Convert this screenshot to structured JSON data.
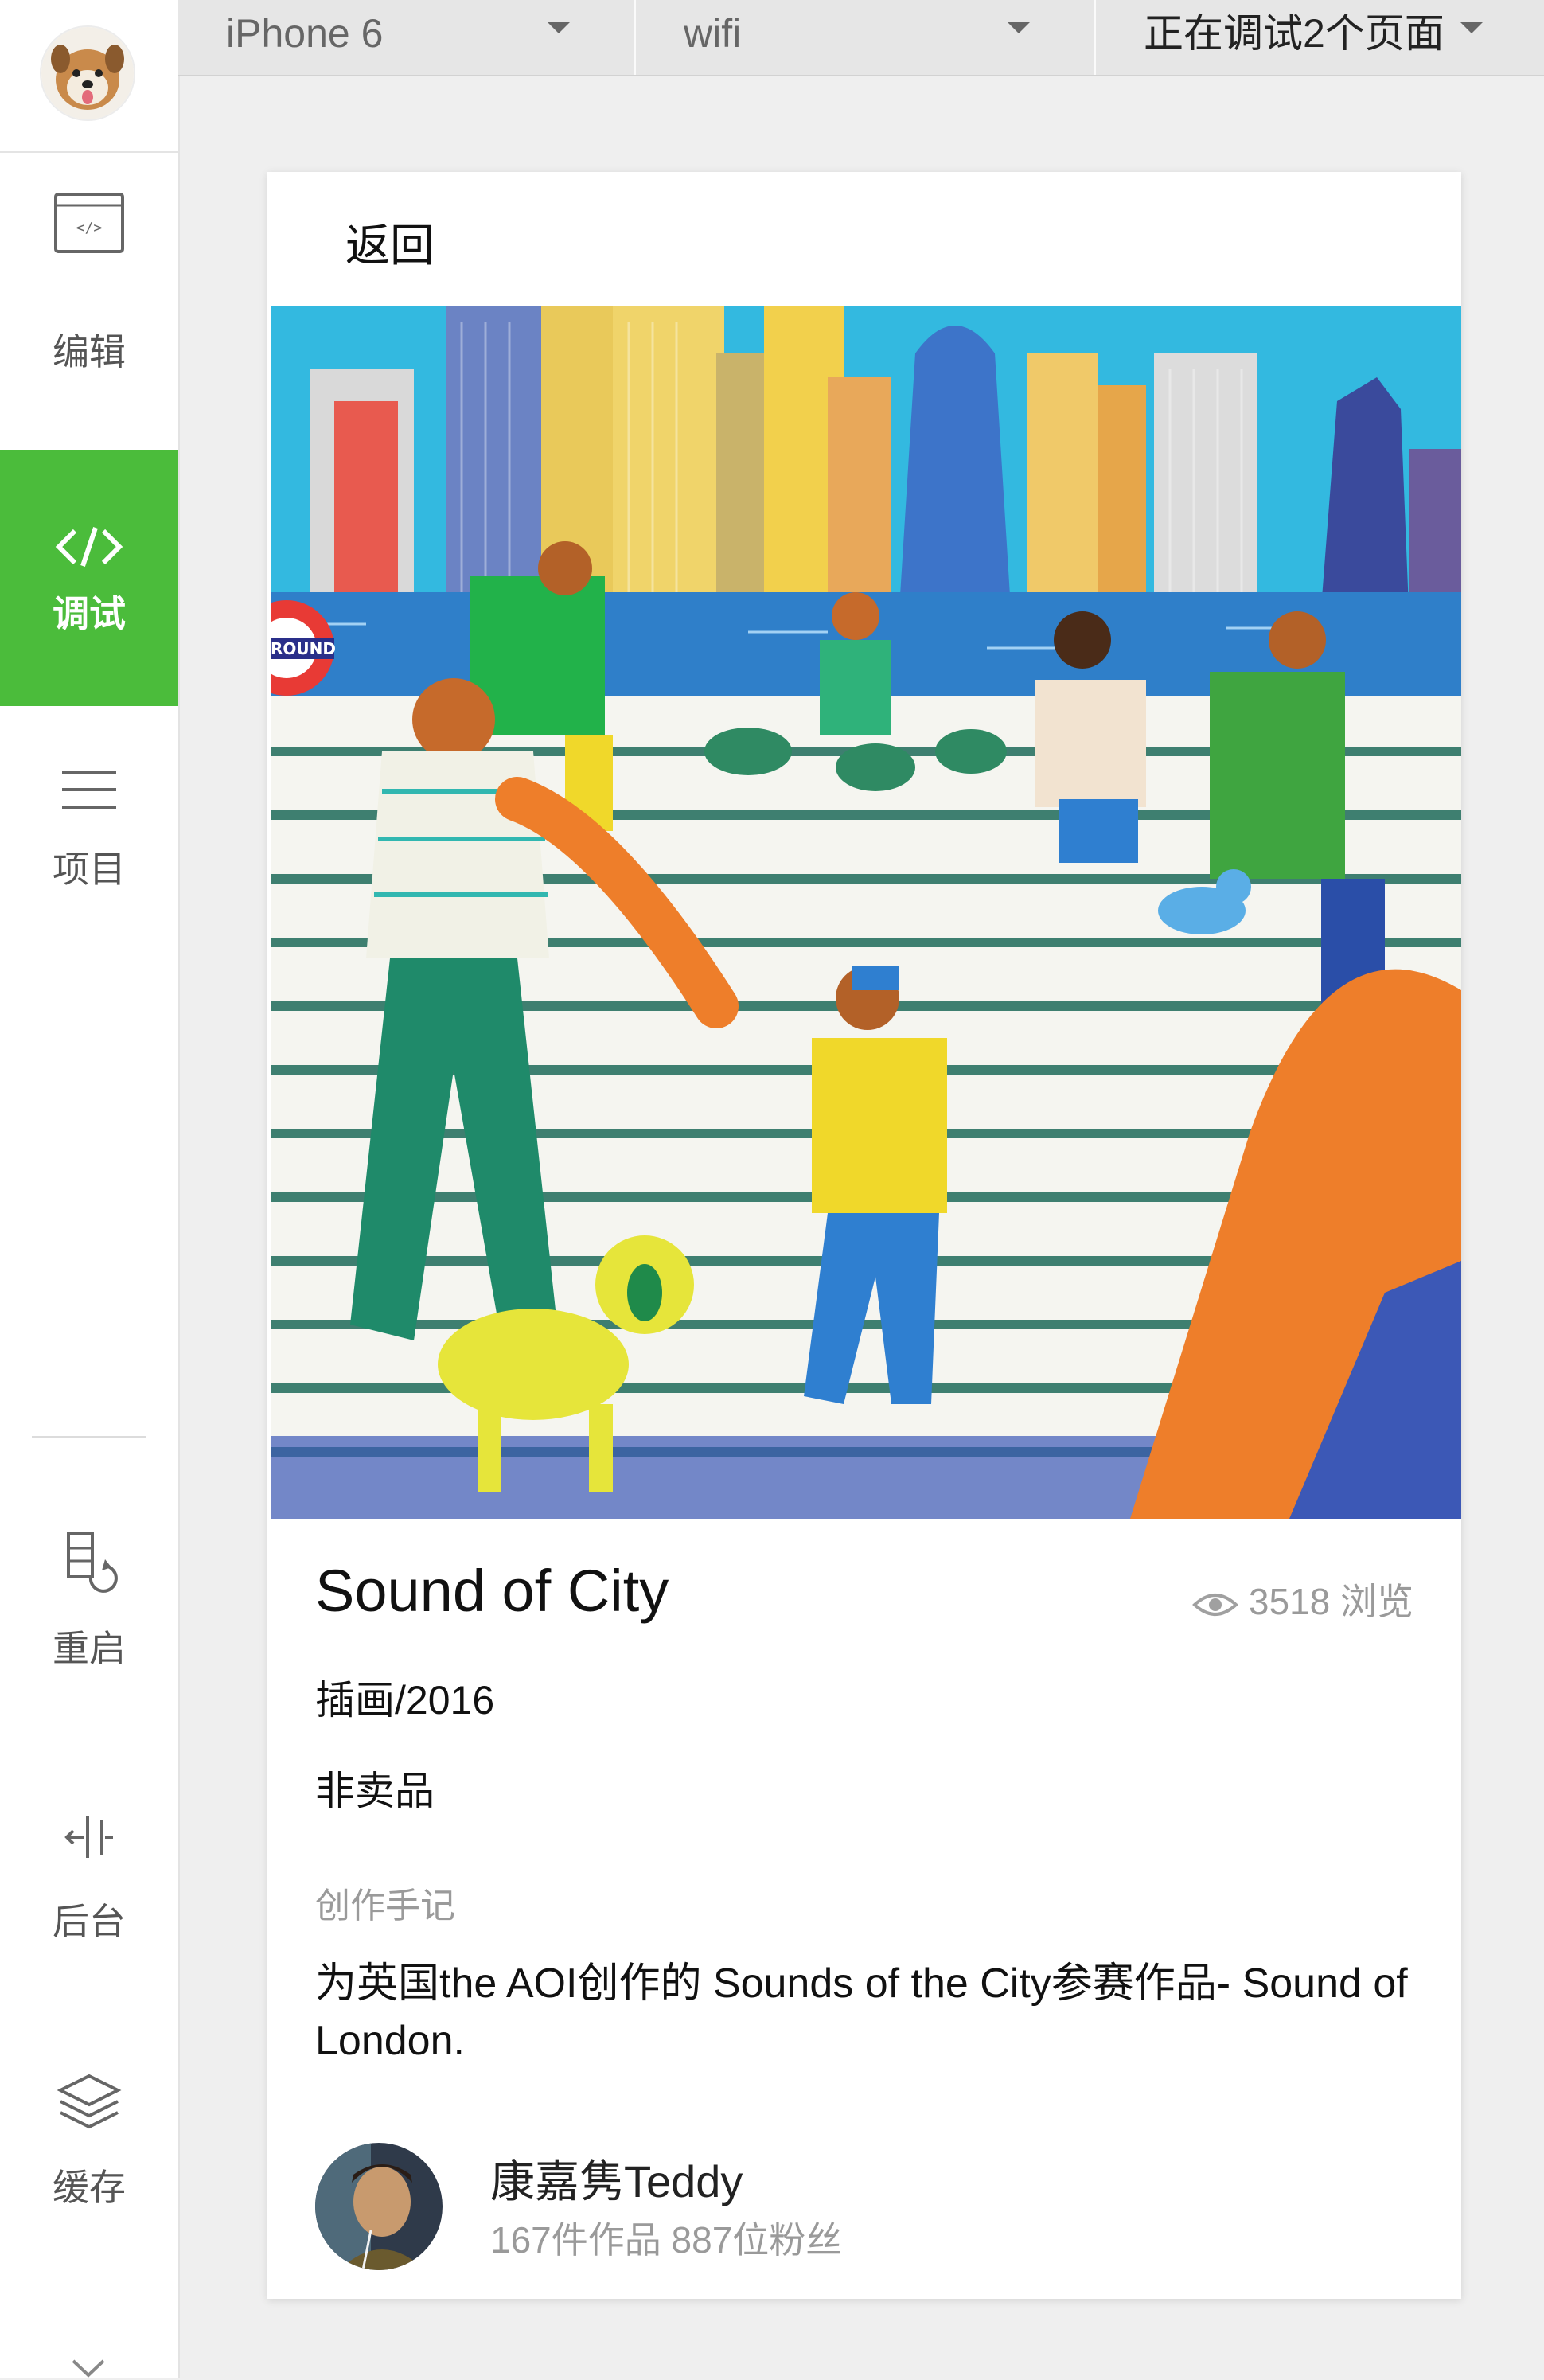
{
  "topbar": {
    "device": "iPhone 6",
    "network": "wifi",
    "pages": "正在调试2个页面"
  },
  "sidebar": {
    "items": [
      {
        "label": "编辑",
        "icon": "code-window-icon"
      },
      {
        "label": "调试",
        "icon": "code-brackets-icon"
      },
      {
        "label": "项目",
        "icon": "hamburger-menu-icon"
      },
      {
        "label": "重启",
        "icon": "restart-icon"
      },
      {
        "label": "后台",
        "icon": "background-icon"
      },
      {
        "label": "缓存",
        "icon": "layers-icon"
      }
    ],
    "active_index": 1
  },
  "card": {
    "back_label": "返回",
    "title": "Sound of City",
    "views": "3518 浏览",
    "category": "插画/2016",
    "sale_status": "非卖品",
    "notes_label": "创作手记",
    "notes": "为英国the AOI创作的 Sounds of the City参赛作品- Sound of London.",
    "author_name": "康嘉隽Teddy",
    "author_stats": "167件作品 887位粉丝",
    "artwork_sign_text": "ROUND"
  },
  "colors": {
    "accent": "#4bbc3b",
    "topbar_bg": "#e6e6e6",
    "page_bg": "#efefef",
    "muted_text": "#9a9a9a"
  }
}
